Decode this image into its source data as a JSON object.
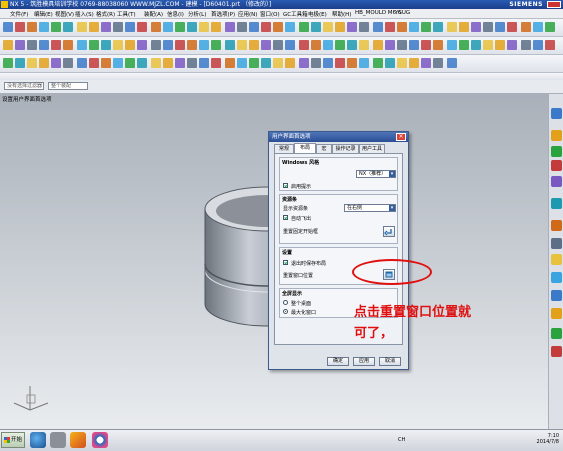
{
  "window": {
    "title": "NX 5 - 筑胜模具培训学校  0769-88038060  WWW.MJZL.COM - 建模 - [D60401.prt （修改的）]",
    "brand": "SIEMENS"
  },
  "menubar": {
    "items": [
      "文件(F)",
      "编辑(E)",
      "视图(V)",
      "插入(S)",
      "格式(R)",
      "工具(T)",
      "装配(A)",
      "信息(I)",
      "分析(L)",
      "首选项(P)",
      "应用(N)",
      "窗口(O)",
      "GC工具箱",
      "电极(E)",
      "帮助(H)",
      "HB_MOULD M6.6",
      "YSUG"
    ]
  },
  "selection": {
    "filter": "没有选择过滤器",
    "scope": "整个装配"
  },
  "view": {
    "title": "设置用户界面首选项"
  },
  "dialog": {
    "title": "用户界面首选项",
    "tabs": [
      "常规",
      "布局",
      "宏",
      "操作记录",
      "用户工具"
    ],
    "active_tab": "布局",
    "windows_style": {
      "heading": "Windows 风格",
      "style_value": "NX（推荐）",
      "show_ribbon_label": "启用提示"
    },
    "resource_bar": {
      "heading": "资源条",
      "display_label": "显示资源条",
      "display_value": "在右侧",
      "autofly_label": "自动飞出",
      "reset_label": "重置固定开始框"
    },
    "settings": {
      "heading": "设置",
      "save_layout_label": "退出时保存布局",
      "reset_window_label": "重置窗口位置"
    },
    "fullscreen": {
      "heading": "全屏显示",
      "option1": "整个桌面",
      "option2": "最大化窗口"
    },
    "buttons": {
      "ok": "确定",
      "apply": "应用",
      "cancel": "取消"
    }
  },
  "annotation": {
    "line1": "点击重置窗口位置就",
    "line2": "可了，",
    "color": "#e01010"
  },
  "taskbar": {
    "start": "开始",
    "lang": "CH",
    "time": "7:10",
    "date": "2014/7/8"
  }
}
